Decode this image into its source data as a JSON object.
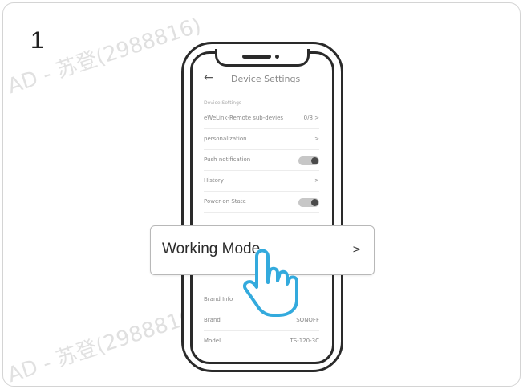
{
  "step_number": "1",
  "watermark": "AD - 苏登(2988816)",
  "watermark_bottom": "AD - 苏登(2988816)",
  "screen": {
    "back_icon": "←",
    "title": "Device Settings",
    "section_label": "Device Settings",
    "rows": [
      {
        "label": "eWeLink-Remote sub-devies",
        "value": "0/8 >"
      },
      {
        "label": "personalization",
        "value": ">"
      },
      {
        "label": "Push notification",
        "toggle": true
      },
      {
        "label": "History",
        "value": ">"
      },
      {
        "label": "Power-on State",
        "toggle": true
      }
    ],
    "info_rows": [
      {
        "label": "Brand Info",
        "value": ""
      },
      {
        "label": "Brand",
        "value": "SONOFF"
      },
      {
        "label": "Model",
        "value": "TS-120-3C"
      }
    ]
  },
  "popup": {
    "label": "Working Mode",
    "chevron": ">"
  },
  "icons": {
    "back": "arrow-left-icon",
    "hand": "hand-pointer-icon",
    "chevron": "chevron-right-icon"
  },
  "colors": {
    "hand_outline": "#33aadd",
    "frame": "#2a2a2a"
  }
}
